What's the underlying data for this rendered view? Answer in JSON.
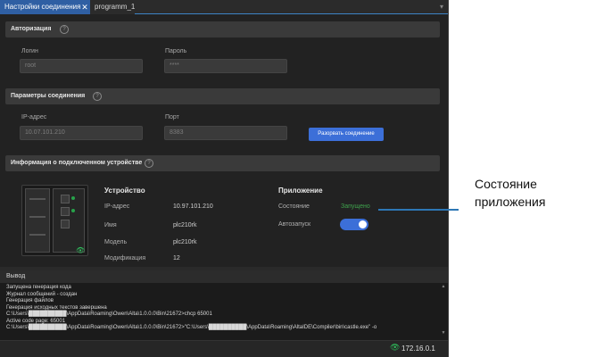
{
  "tabs": [
    {
      "label": "Настройки соединения",
      "active": true
    },
    {
      "label": "programm_1",
      "active": false
    }
  ],
  "auth": {
    "title": "Авторизация",
    "login_label": "Логин",
    "login_value": "root",
    "password_label": "Пароль",
    "password_value": "****"
  },
  "conn": {
    "title": "Параметры соединения",
    "ip_label": "IP-адрес",
    "ip_value": "10.07.101.210",
    "port_label": "Порт",
    "port_value": "8383",
    "disconnect_button": "Разорвать соединение"
  },
  "device_info": {
    "title": "Информация о подключенном устройстве",
    "device_header": "Устройство",
    "rows": [
      {
        "key": "IP-адрес",
        "value": "10.97.101.210"
      },
      {
        "key": "Имя",
        "value": "plc210rk"
      },
      {
        "key": "Модель",
        "value": "plc210rk"
      },
      {
        "key": "Модификация",
        "value": "12"
      }
    ],
    "app_header": "Приложение",
    "state_label": "Состояние",
    "state_value": "Запущено",
    "autostart_label": "Автозапуск",
    "autostart_on": true
  },
  "output": {
    "title": "Вывод",
    "lines": [
      "Запущена генерация кода",
      "Журнал сообщений - создан",
      "Генерация файлов",
      "Генерация исходных текстов завершена",
      "C:\\Users\\██████████\\AppData\\Roaming\\Owen\\Alta\\1.0.0.0\\Bin\\21672>chcp 65001",
      "Active code page: 65001",
      "C:\\Users\\██████████\\AppData\\Roaming\\Owen\\Alta\\1.0.0.0\\Bin\\21672>\"C:\\Users\\██████████\\AppData\\Roaming\\AltaIDE\\Compiler\\bin\\castle.exe\" -o"
    ]
  },
  "status": {
    "ip": "172.16.0.1"
  },
  "callout": {
    "text": "Состояние приложения"
  },
  "colors": {
    "accent": "#3c6fd8",
    "running": "#3fa34d",
    "callout": "#2d77b5"
  },
  "icons": [
    "close-icon",
    "help-icon",
    "eye-icon",
    "scroll-arrow-icon"
  ]
}
